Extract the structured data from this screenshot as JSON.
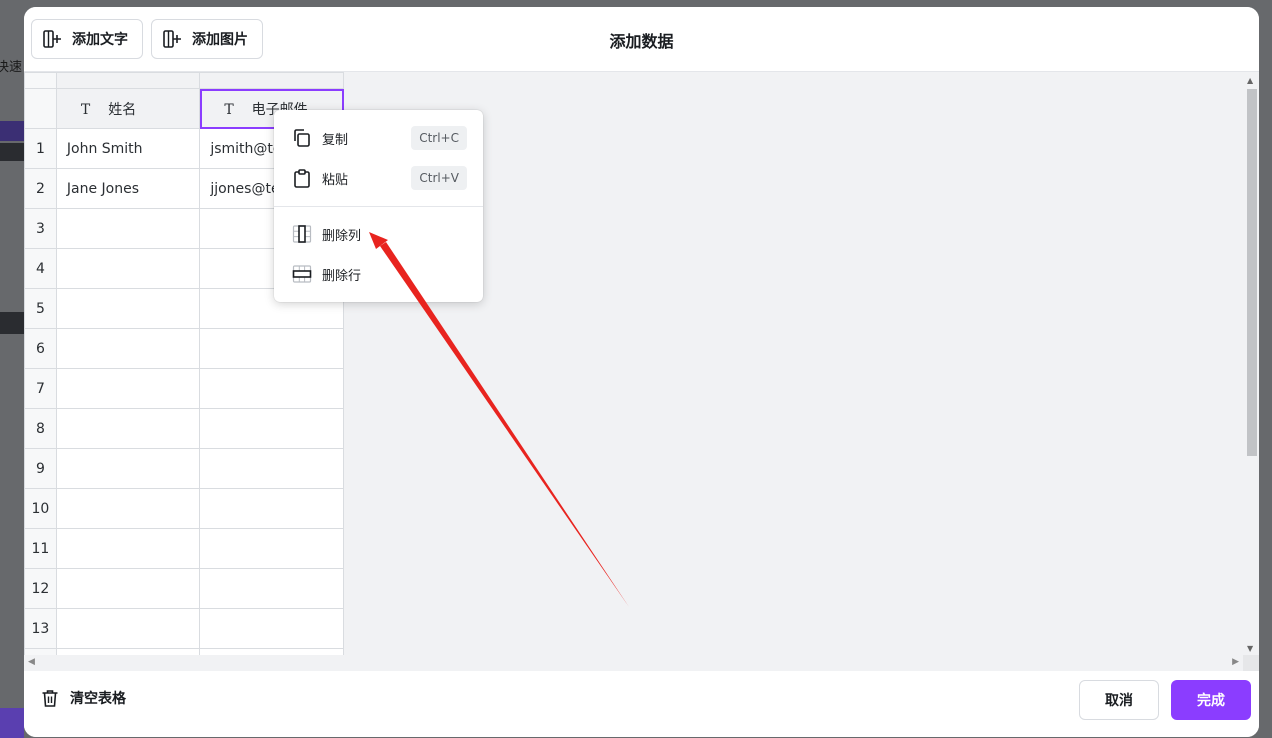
{
  "background": {
    "partial_text": "决速"
  },
  "header": {
    "add_text_label": "添加文字",
    "add_image_label": "添加图片",
    "title": "添加数据"
  },
  "grid": {
    "column_type_icon": "T",
    "columns": [
      "姓名",
      "电子邮件"
    ],
    "rows": [
      {
        "num": "1",
        "c1": "John Smith",
        "c2": "jsmith@te"
      },
      {
        "num": "2",
        "c1": "Jane Jones",
        "c2": "jjones@te"
      },
      {
        "num": "3",
        "c1": "",
        "c2": ""
      },
      {
        "num": "4",
        "c1": "",
        "c2": ""
      },
      {
        "num": "5",
        "c1": "",
        "c2": ""
      },
      {
        "num": "6",
        "c1": "",
        "c2": ""
      },
      {
        "num": "7",
        "c1": "",
        "c2": ""
      },
      {
        "num": "8",
        "c1": "",
        "c2": ""
      },
      {
        "num": "9",
        "c1": "",
        "c2": ""
      },
      {
        "num": "10",
        "c1": "",
        "c2": ""
      },
      {
        "num": "11",
        "c1": "",
        "c2": ""
      },
      {
        "num": "12",
        "c1": "",
        "c2": ""
      },
      {
        "num": "13",
        "c1": "",
        "c2": ""
      }
    ]
  },
  "context_menu": {
    "copy_label": "复制",
    "copy_shortcut": "Ctrl+C",
    "paste_label": "粘贴",
    "paste_shortcut": "Ctrl+V",
    "delete_column_label": "删除列",
    "delete_row_label": "删除行"
  },
  "footer": {
    "clear_label": "清空表格",
    "cancel_label": "取消",
    "done_label": "完成"
  },
  "colors": {
    "accent": "#8b3dff",
    "annotation_arrow": "#e8241f"
  }
}
